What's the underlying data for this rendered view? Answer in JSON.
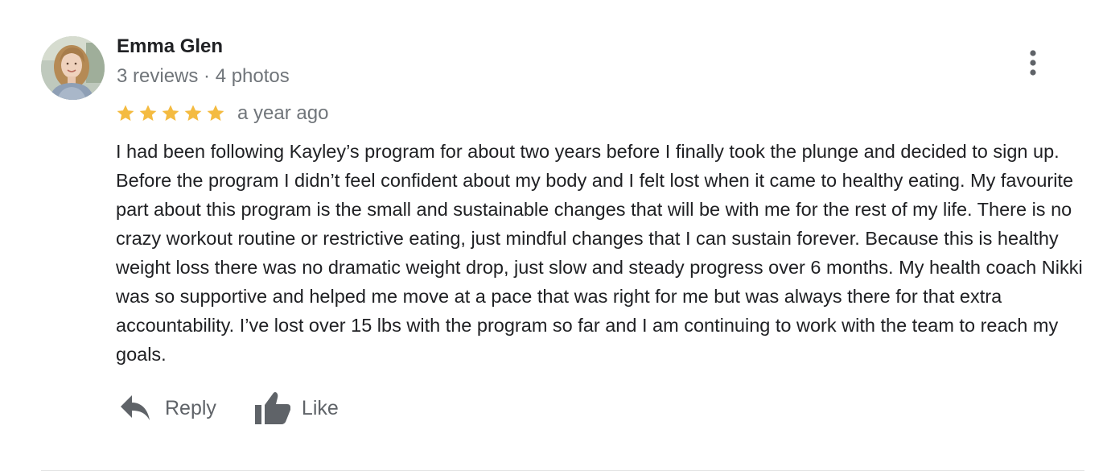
{
  "review": {
    "author": {
      "name": "Emma Glen",
      "meta": "3 reviews · 4 photos"
    },
    "rating": 5,
    "rating_max": 5,
    "star_color": "#f4bb41",
    "date": "a year ago",
    "text": "I had been following Kayley’s program for about two years before I finally took the plunge and decided to sign up. Before the program I didn’t feel confident about my body and I felt lost when it came to healthy eating. My favourite part about this program is the small and sustainable changes that will be with me for the rest of my life. There is no crazy workout routine or restrictive eating, just mindful changes that I can sustain forever. Because this is healthy weight loss there was no dramatic weight drop, just slow and steady progress over 6 months. My health coach Nikki was so supportive and helped me move at a pace that was right for me but was always there for that extra accountability. I’ve lost over 15 lbs with the program so far and I am continuing to work with the team to reach my goals.",
    "actions": {
      "reply_label": "Reply",
      "like_label": "Like"
    },
    "icons": {
      "more": "more-vert-icon",
      "reply": "reply-icon",
      "like": "thumb-up-icon",
      "star": "star-icon"
    }
  }
}
